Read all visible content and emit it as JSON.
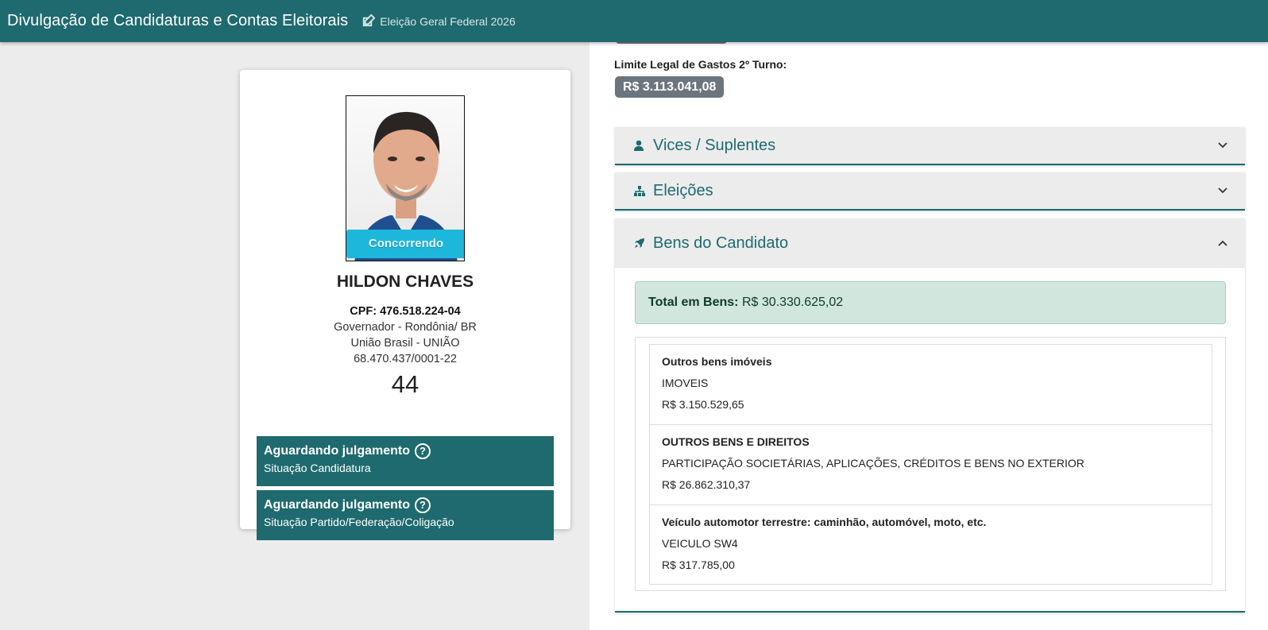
{
  "header": {
    "title": "Divulgação de Candidaturas e Contas Eleitorais",
    "election": "Eleição Geral Federal 2026",
    "edit_icon": "edit-icon"
  },
  "candidate": {
    "badge": "Concorrendo",
    "name": "HILDON CHAVES",
    "cpf": "CPF: 476.518.224-04",
    "cargo": "Governador - Rondônia/ BR",
    "partido": "União Brasil - UNIÃO",
    "cnpj": "68.470.437/0001-22",
    "numero": "44",
    "status": [
      {
        "title": "Aguardando julgamento",
        "subtitle": "Situação Candidatura"
      },
      {
        "title": "Aguardando julgamento",
        "subtitle": "Situação Partido/Federação/Coligação"
      }
    ]
  },
  "limits": {
    "label_2turno": "Limite Legal de Gastos 2º Turno:",
    "value_2turno": "R$ 3.113.041,08"
  },
  "accordions": [
    {
      "label": "Vices / Suplentes",
      "icon": "user-icon",
      "expanded": false
    },
    {
      "label": "Eleições",
      "icon": "sitemap-icon",
      "expanded": false
    },
    {
      "label": "Bens do Candidato",
      "icon": "rocket-icon",
      "expanded": true
    }
  ],
  "bens": {
    "total_label": "Total em Bens:",
    "total_value": "R$ 30.330.625,02",
    "items": [
      {
        "tipo": "Outros bens imóveis",
        "descricao": "IMOVEIS",
        "valor": "R$ 3.150.529,65"
      },
      {
        "tipo": "OUTROS BENS E DIREITOS",
        "descricao": "PARTICIPAÇÃO SOCIETÁRIAS, APLICAÇÕES, CRÉDITOS E BENS NO EXTERIOR",
        "valor": "R$ 26.862.310,37"
      },
      {
        "tipo": "Veículo automotor terrestre: caminhão, automóvel, moto, etc.",
        "descricao": "VEICULO SW4",
        "valor": "R$ 317.785,00"
      }
    ]
  },
  "colors": {
    "primary": "#1e6a6e",
    "badge": "#1eb7dc",
    "limit_badge": "#6c757d",
    "total_bg": "#d1e7dd"
  }
}
